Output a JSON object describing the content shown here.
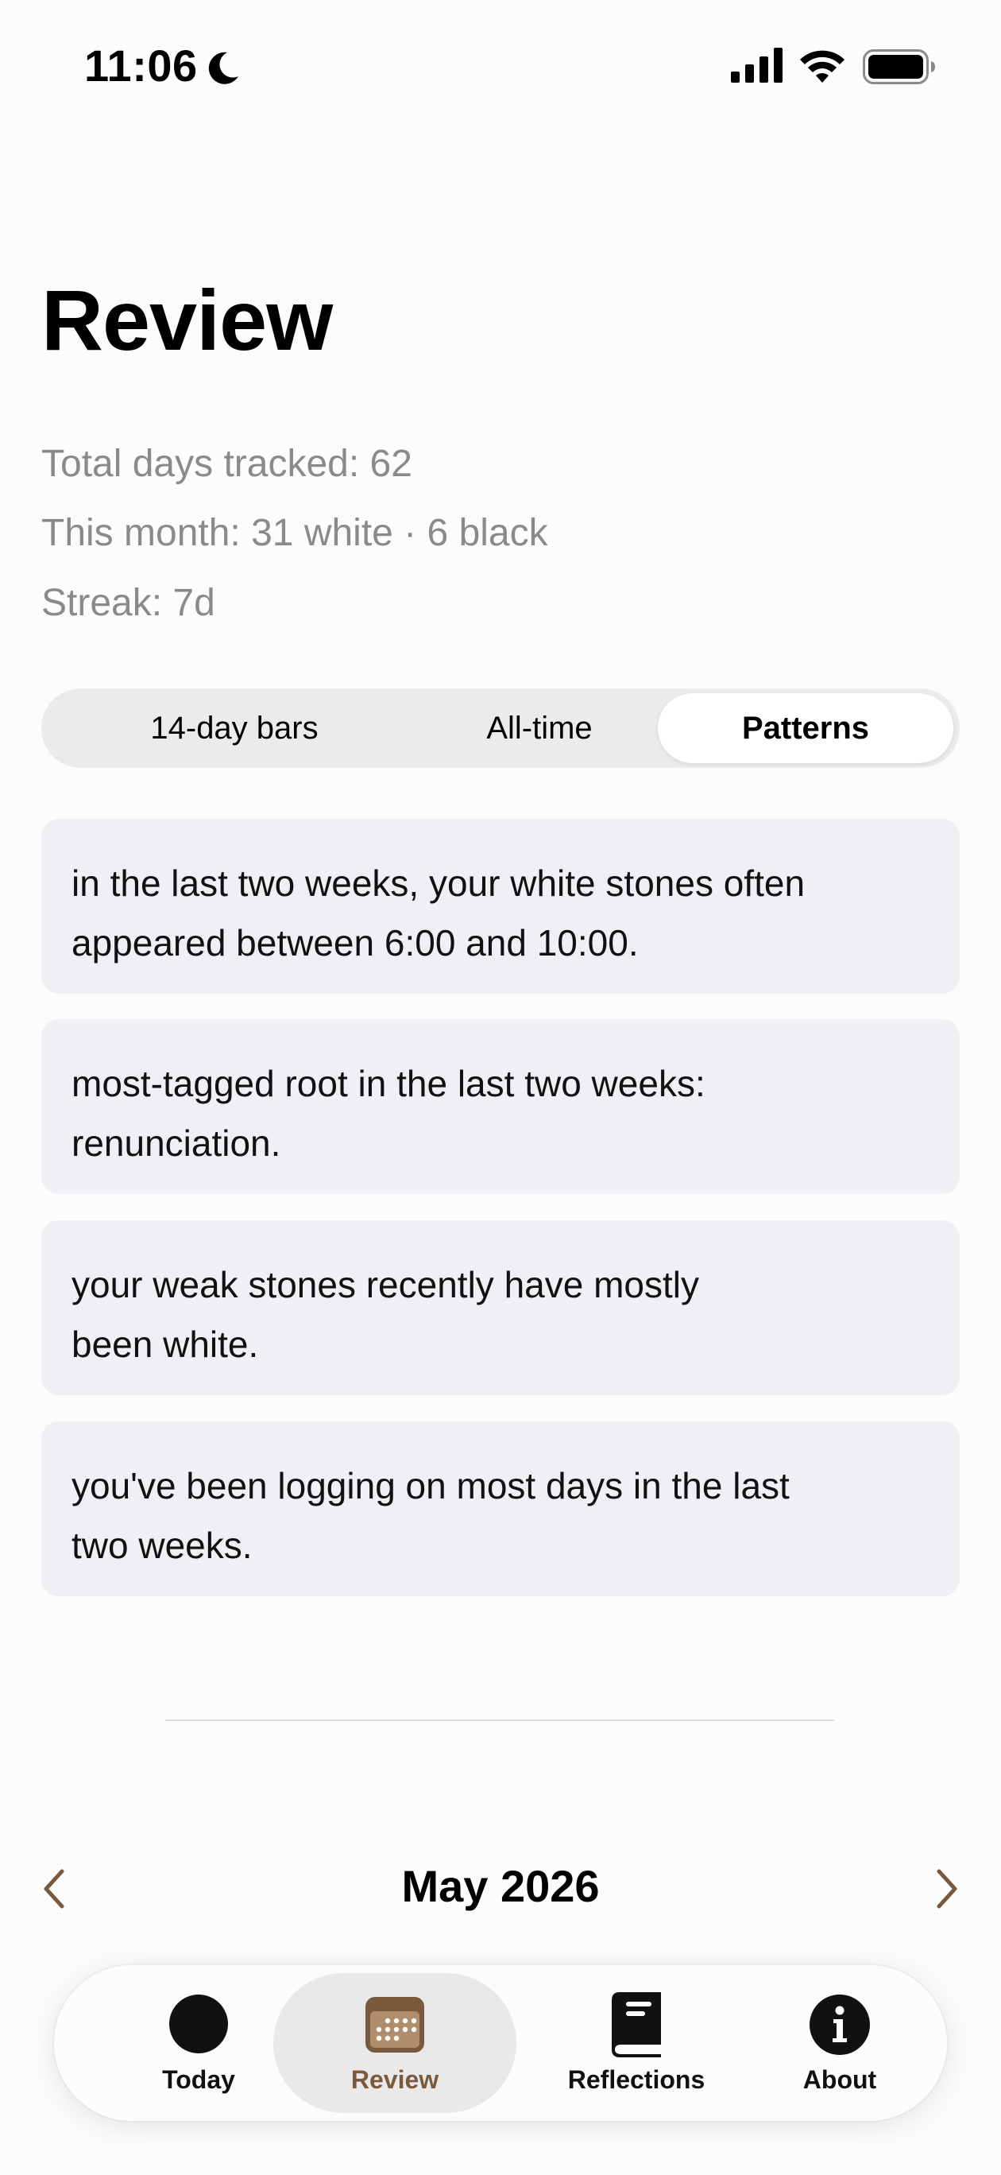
{
  "status_bar": {
    "time": "11:06",
    "icons": [
      "moon-icon",
      "signal-icon",
      "wifi-icon",
      "battery-icon"
    ]
  },
  "header": {
    "title": "Review"
  },
  "stats": {
    "total": "Total days tracked: 62",
    "month": "This month: 31 white · 6 black",
    "streak": "Streak: 7d"
  },
  "segmented_control": {
    "options": [
      {
        "label": "14-day bars",
        "selected": false
      },
      {
        "label": "All-time",
        "selected": false
      },
      {
        "label": "Patterns",
        "selected": true
      }
    ]
  },
  "insights": [
    {
      "line1": "in the last two weeks, your white stones often",
      "line2": "appeared between 6:00 and 10:00."
    },
    {
      "line1": "most-tagged root in the last two weeks:",
      "line2": "renunciation."
    },
    {
      "line1": "your weak stones recently have mostly",
      "line2": "been white."
    },
    {
      "line1": "you've been logging on most days in the last",
      "line2": "two weeks."
    }
  ],
  "month_nav": {
    "label": "May 2026",
    "prev_icon": "chevron-left-icon",
    "next_icon": "chevron-right-icon"
  },
  "tab_bar": {
    "tabs": [
      {
        "label": "Today",
        "icon": "black-stone-icon",
        "selected": false
      },
      {
        "label": "Review",
        "icon": "calendar-icon",
        "selected": true
      },
      {
        "label": "Reflections",
        "icon": "book-icon",
        "selected": false
      },
      {
        "label": "About",
        "icon": "info-icon",
        "selected": false
      }
    ]
  },
  "colors": {
    "accent": "#7a5a3c",
    "secondary_text": "#8a8a8e",
    "card_background": "#f0eff4",
    "segment_track": "#ebebeb"
  }
}
